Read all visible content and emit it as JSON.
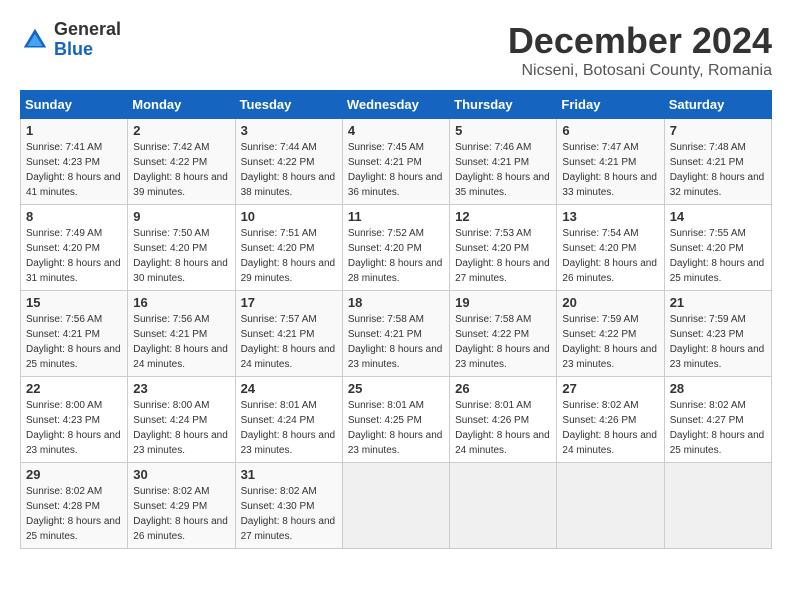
{
  "header": {
    "logo_general": "General",
    "logo_blue": "Blue",
    "title": "December 2024",
    "subtitle": "Nicseni, Botosani County, Romania"
  },
  "calendar": {
    "weekdays": [
      "Sunday",
      "Monday",
      "Tuesday",
      "Wednesday",
      "Thursday",
      "Friday",
      "Saturday"
    ],
    "weeks": [
      [
        {
          "day": "1",
          "sunrise": "7:41 AM",
          "sunset": "4:23 PM",
          "daylight": "8 hours and 41 minutes."
        },
        {
          "day": "2",
          "sunrise": "7:42 AM",
          "sunset": "4:22 PM",
          "daylight": "8 hours and 39 minutes."
        },
        {
          "day": "3",
          "sunrise": "7:44 AM",
          "sunset": "4:22 PM",
          "daylight": "8 hours and 38 minutes."
        },
        {
          "day": "4",
          "sunrise": "7:45 AM",
          "sunset": "4:21 PM",
          "daylight": "8 hours and 36 minutes."
        },
        {
          "day": "5",
          "sunrise": "7:46 AM",
          "sunset": "4:21 PM",
          "daylight": "8 hours and 35 minutes."
        },
        {
          "day": "6",
          "sunrise": "7:47 AM",
          "sunset": "4:21 PM",
          "daylight": "8 hours and 33 minutes."
        },
        {
          "day": "7",
          "sunrise": "7:48 AM",
          "sunset": "4:21 PM",
          "daylight": "8 hours and 32 minutes."
        }
      ],
      [
        {
          "day": "8",
          "sunrise": "7:49 AM",
          "sunset": "4:20 PM",
          "daylight": "8 hours and 31 minutes."
        },
        {
          "day": "9",
          "sunrise": "7:50 AM",
          "sunset": "4:20 PM",
          "daylight": "8 hours and 30 minutes."
        },
        {
          "day": "10",
          "sunrise": "7:51 AM",
          "sunset": "4:20 PM",
          "daylight": "8 hours and 29 minutes."
        },
        {
          "day": "11",
          "sunrise": "7:52 AM",
          "sunset": "4:20 PM",
          "daylight": "8 hours and 28 minutes."
        },
        {
          "day": "12",
          "sunrise": "7:53 AM",
          "sunset": "4:20 PM",
          "daylight": "8 hours and 27 minutes."
        },
        {
          "day": "13",
          "sunrise": "7:54 AM",
          "sunset": "4:20 PM",
          "daylight": "8 hours and 26 minutes."
        },
        {
          "day": "14",
          "sunrise": "7:55 AM",
          "sunset": "4:20 PM",
          "daylight": "8 hours and 25 minutes."
        }
      ],
      [
        {
          "day": "15",
          "sunrise": "7:56 AM",
          "sunset": "4:21 PM",
          "daylight": "8 hours and 25 minutes."
        },
        {
          "day": "16",
          "sunrise": "7:56 AM",
          "sunset": "4:21 PM",
          "daylight": "8 hours and 24 minutes."
        },
        {
          "day": "17",
          "sunrise": "7:57 AM",
          "sunset": "4:21 PM",
          "daylight": "8 hours and 24 minutes."
        },
        {
          "day": "18",
          "sunrise": "7:58 AM",
          "sunset": "4:21 PM",
          "daylight": "8 hours and 23 minutes."
        },
        {
          "day": "19",
          "sunrise": "7:58 AM",
          "sunset": "4:22 PM",
          "daylight": "8 hours and 23 minutes."
        },
        {
          "day": "20",
          "sunrise": "7:59 AM",
          "sunset": "4:22 PM",
          "daylight": "8 hours and 23 minutes."
        },
        {
          "day": "21",
          "sunrise": "7:59 AM",
          "sunset": "4:23 PM",
          "daylight": "8 hours and 23 minutes."
        }
      ],
      [
        {
          "day": "22",
          "sunrise": "8:00 AM",
          "sunset": "4:23 PM",
          "daylight": "8 hours and 23 minutes."
        },
        {
          "day": "23",
          "sunrise": "8:00 AM",
          "sunset": "4:24 PM",
          "daylight": "8 hours and 23 minutes."
        },
        {
          "day": "24",
          "sunrise": "8:01 AM",
          "sunset": "4:24 PM",
          "daylight": "8 hours and 23 minutes."
        },
        {
          "day": "25",
          "sunrise": "8:01 AM",
          "sunset": "4:25 PM",
          "daylight": "8 hours and 23 minutes."
        },
        {
          "day": "26",
          "sunrise": "8:01 AM",
          "sunset": "4:26 PM",
          "daylight": "8 hours and 24 minutes."
        },
        {
          "day": "27",
          "sunrise": "8:02 AM",
          "sunset": "4:26 PM",
          "daylight": "8 hours and 24 minutes."
        },
        {
          "day": "28",
          "sunrise": "8:02 AM",
          "sunset": "4:27 PM",
          "daylight": "8 hours and 25 minutes."
        }
      ],
      [
        {
          "day": "29",
          "sunrise": "8:02 AM",
          "sunset": "4:28 PM",
          "daylight": "8 hours and 25 minutes."
        },
        {
          "day": "30",
          "sunrise": "8:02 AM",
          "sunset": "4:29 PM",
          "daylight": "8 hours and 26 minutes."
        },
        {
          "day": "31",
          "sunrise": "8:02 AM",
          "sunset": "4:30 PM",
          "daylight": "8 hours and 27 minutes."
        },
        null,
        null,
        null,
        null
      ]
    ]
  }
}
